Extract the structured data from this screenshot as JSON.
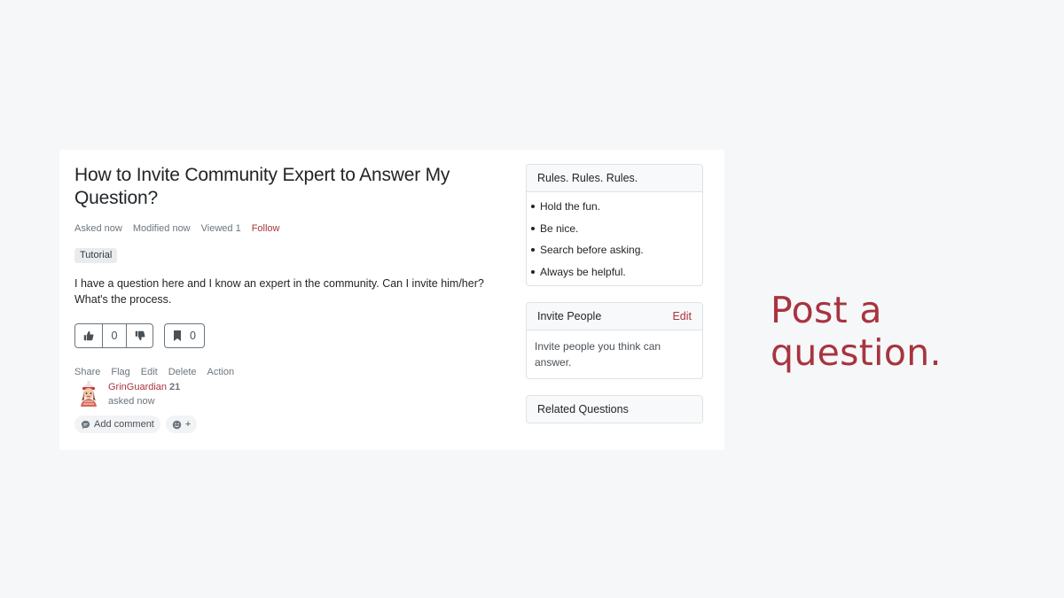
{
  "question": {
    "title": "How to Invite Community Expert to Answer My Question?",
    "meta": {
      "asked": "Asked now",
      "modified": "Modified now",
      "viewed": "Viewed 1",
      "follow": "Follow"
    },
    "tag": "Tutorial",
    "body": "I have a question here and I know an expert in the community. Can I invite him/her? What's the process.",
    "votes": "0",
    "bookmarks": "0",
    "actions": [
      "Share",
      "Flag",
      "Edit",
      "Delete",
      "Action"
    ],
    "author": {
      "name": "GrinGuardian",
      "reputation": "21",
      "time": "asked now"
    },
    "add_comment": "Add comment",
    "reaction_plus": "+"
  },
  "sidebar": {
    "rules": {
      "title": "Rules. Rules. Rules.",
      "items": [
        "Hold the fun.",
        "Be nice.",
        "Search before asking.",
        "Always be helpful."
      ]
    },
    "invite": {
      "title": "Invite People",
      "edit": "Edit",
      "description": "Invite people you think can answer."
    },
    "related": {
      "title": "Related Questions"
    }
  },
  "caption": "Post a question.",
  "colors": {
    "accent": "#a8343f",
    "background": "#f6f7f9",
    "muted": "#6c757d"
  },
  "icons": {
    "upvote": "thumbs-up-icon",
    "downvote": "thumbs-down-icon",
    "bookmark": "bookmark-icon",
    "comment": "chat-bubble-icon",
    "reaction": "smile-icon"
  }
}
